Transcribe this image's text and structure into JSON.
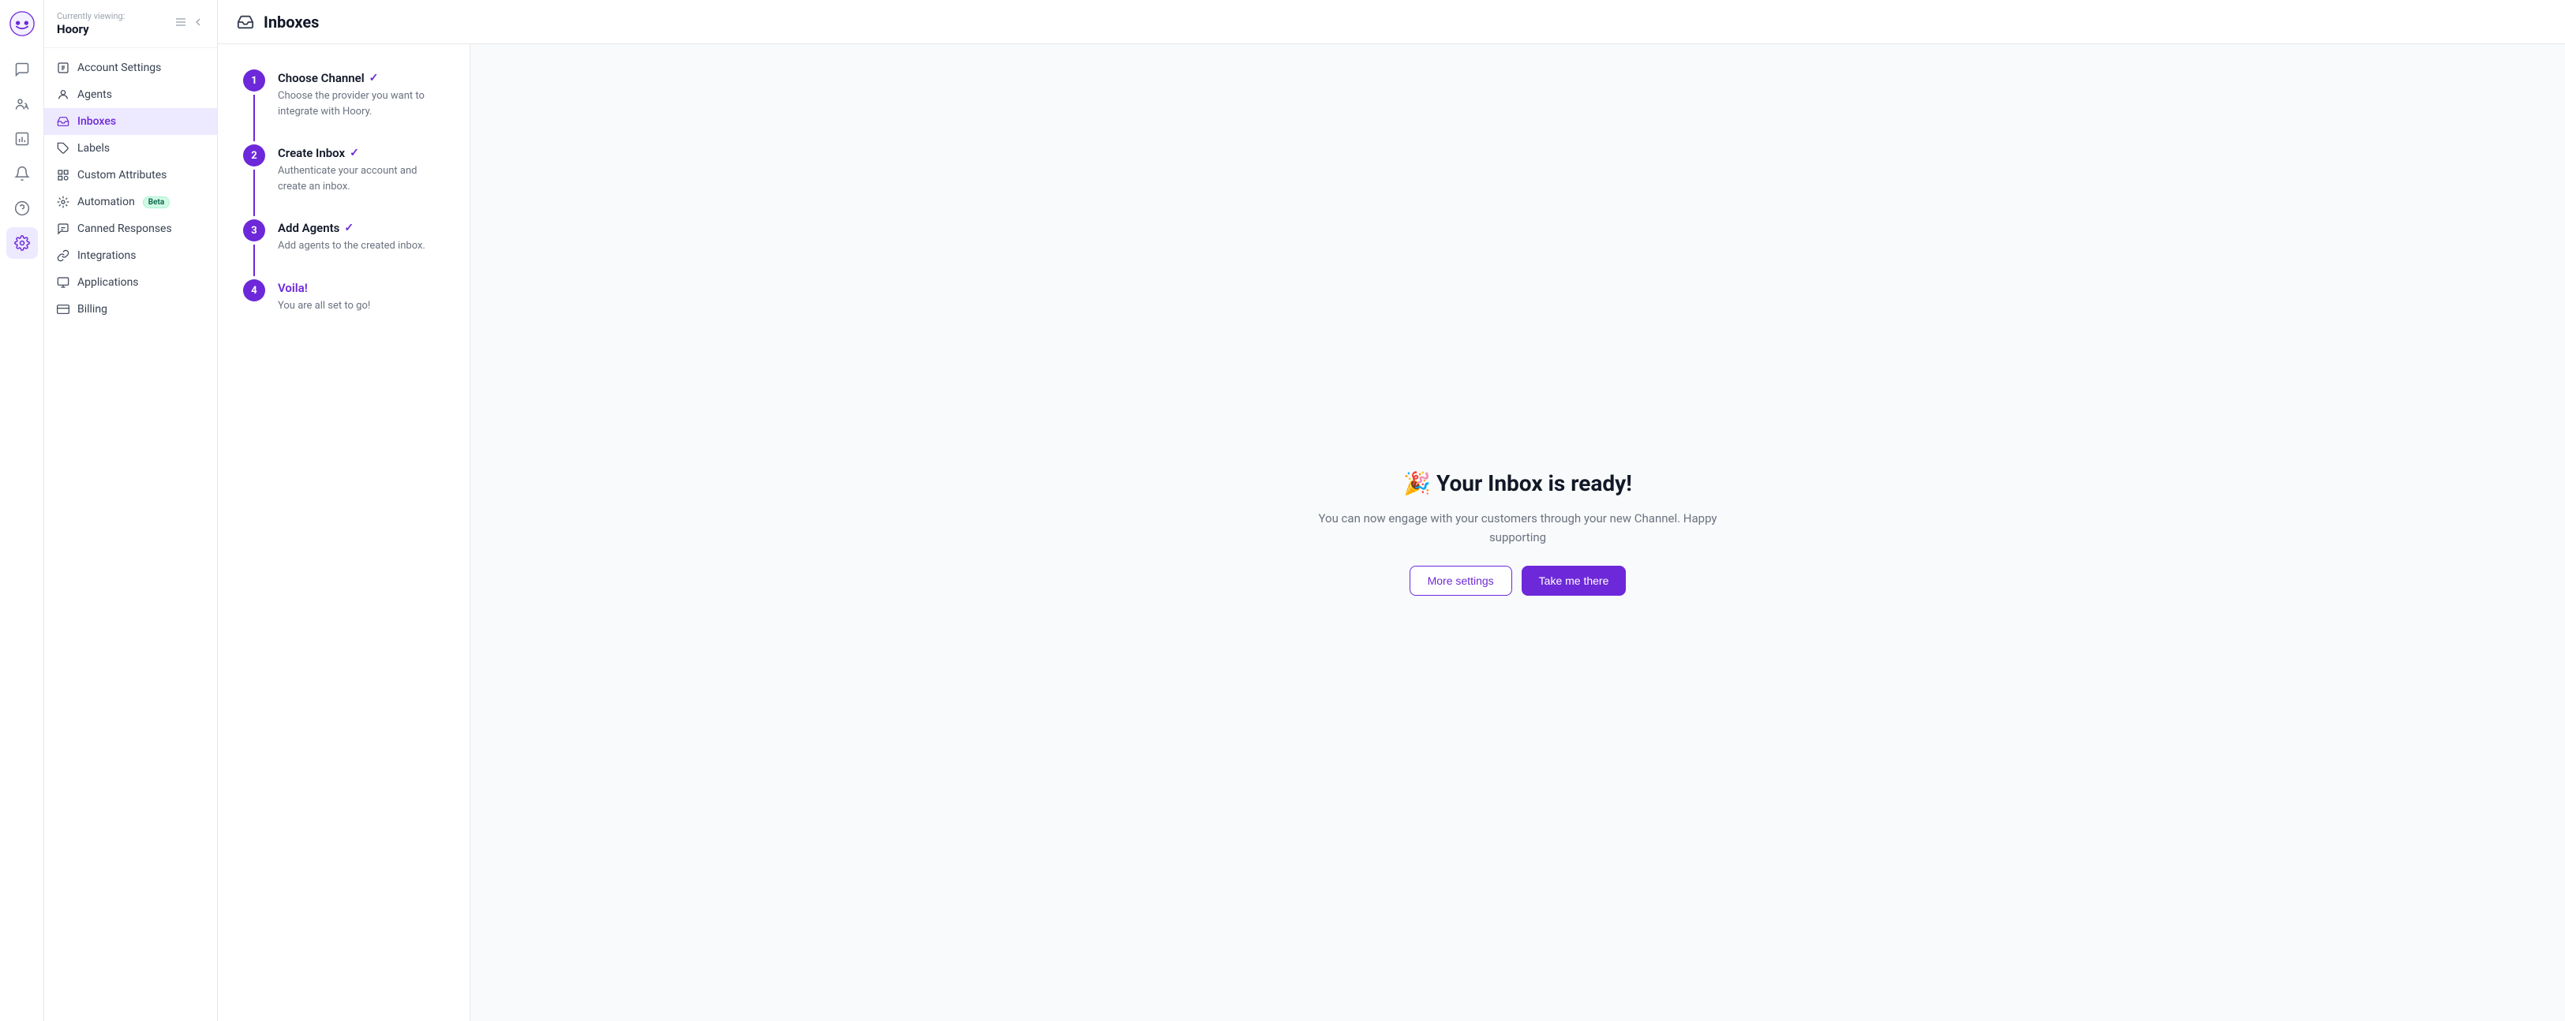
{
  "app": {
    "logo_alt": "Chatwoot logo"
  },
  "sidebar_header": {
    "currently_label": "Currently viewing:",
    "org_name": "Hoory"
  },
  "icon_nav": {
    "items": [
      {
        "name": "conversations-icon",
        "label": "Conversations"
      },
      {
        "name": "contacts-icon",
        "label": "Contacts"
      },
      {
        "name": "reports-icon",
        "label": "Reports"
      },
      {
        "name": "notifications-icon",
        "label": "Notifications"
      },
      {
        "name": "help-icon",
        "label": "Help"
      },
      {
        "name": "settings-icon",
        "label": "Settings"
      }
    ]
  },
  "sidebar": {
    "items": [
      {
        "name": "account-settings",
        "label": "Account Settings"
      },
      {
        "name": "agents",
        "label": "Agents"
      },
      {
        "name": "inboxes",
        "label": "Inboxes"
      },
      {
        "name": "labels",
        "label": "Labels"
      },
      {
        "name": "custom-attributes",
        "label": "Custom Attributes"
      },
      {
        "name": "automation",
        "label": "Automation",
        "badge": "Beta"
      },
      {
        "name": "canned-responses",
        "label": "Canned Responses"
      },
      {
        "name": "integrations",
        "label": "Integrations"
      },
      {
        "name": "applications",
        "label": "Applications"
      },
      {
        "name": "billing",
        "label": "Billing"
      }
    ]
  },
  "header": {
    "inbox_icon": "inbox-icon",
    "title": "Inboxes"
  },
  "steps": [
    {
      "number": "1",
      "title": "Choose Channel",
      "check": "✓",
      "desc": "Choose the provider you want to integrate with Hoory."
    },
    {
      "number": "2",
      "title": "Create Inbox",
      "check": "✓",
      "desc": "Authenticate your account and create an inbox."
    },
    {
      "number": "3",
      "title": "Add Agents",
      "check": "✓",
      "desc": "Add agents to the created inbox."
    },
    {
      "number": "4",
      "title": "Voila!",
      "check": "",
      "desc": "You are all set to go!"
    }
  ],
  "success": {
    "emoji": "🎉",
    "title": "Your Inbox is ready!",
    "subtitle": "You can now engage with your customers through your new Channel. Happy supporting",
    "btn_secondary": "More settings",
    "btn_primary": "Take me there"
  }
}
